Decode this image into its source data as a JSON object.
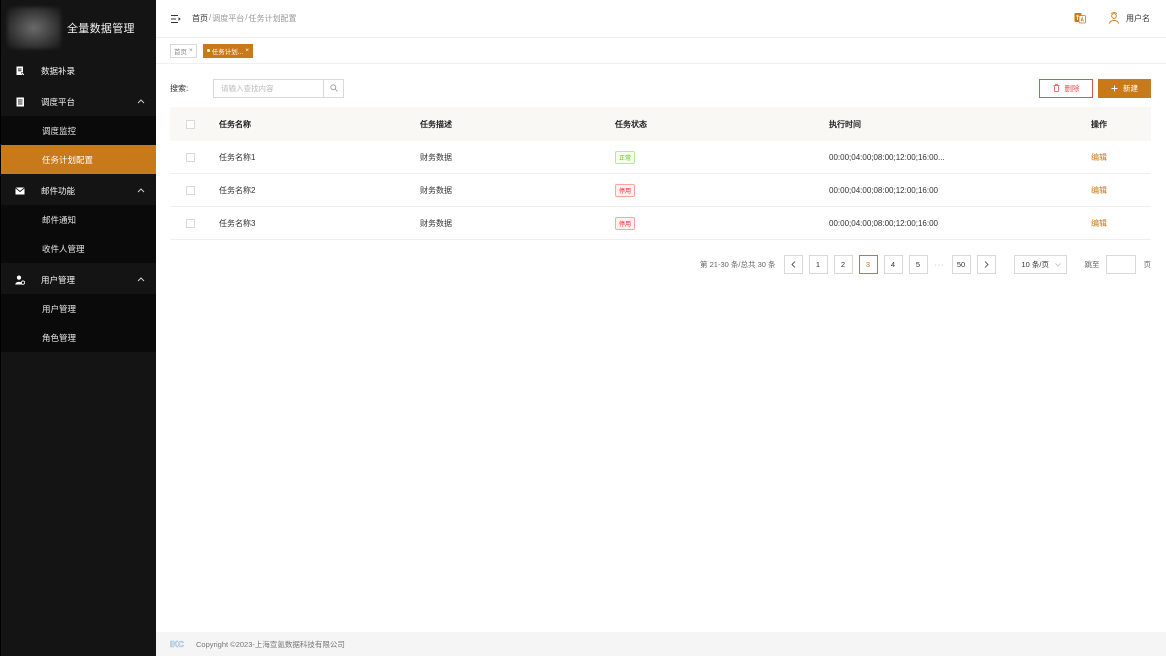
{
  "app": {
    "title": "全量数据管理"
  },
  "colors": {
    "accent": "#c8791a",
    "danger": "#e5534b",
    "sidebar_bg": "#141414"
  },
  "sidebar": {
    "groups": [
      {
        "label": "数据补录",
        "icon": "document-edit-icon",
        "items": []
      },
      {
        "label": "调度平台",
        "icon": "document-list-icon",
        "items": [
          {
            "label": "调度监控"
          },
          {
            "label": "任务计划配置",
            "active": true
          }
        ]
      },
      {
        "label": "邮件功能",
        "icon": "mail-icon",
        "items": [
          {
            "label": "邮件通知"
          },
          {
            "label": "收件人管理"
          }
        ]
      },
      {
        "label": "用户管理",
        "icon": "user-gear-icon",
        "items": [
          {
            "label": "用户管理"
          },
          {
            "label": "角色管理"
          }
        ]
      }
    ]
  },
  "header": {
    "breadcrumb": {
      "home": "首页",
      "sep": "/",
      "level1": "调度平台",
      "level2": "任务计划配置"
    },
    "user_name": "用户名"
  },
  "tags": [
    {
      "label": "首页",
      "close": "×"
    },
    {
      "label": "任务计划...",
      "close": "×",
      "active": true
    }
  ],
  "toolbar": {
    "search_label": "搜索:",
    "search_placeholder": "请输入查找内容",
    "delete_label": "删除",
    "new_label": "新建"
  },
  "table": {
    "columns": {
      "name": "任务名称",
      "desc": "任务描述",
      "status": "任务状态",
      "time": "执行时间",
      "op": "操作"
    },
    "rows": [
      {
        "name": "任务名称1",
        "desc": "财务数据",
        "status": "正常",
        "status_type": "ok",
        "time": "00:00;04:00;08:00;12:00;16:00...",
        "op": "编辑"
      },
      {
        "name": "任务名称2",
        "desc": "财务数据",
        "status": "停用",
        "status_type": "off",
        "time": "00:00;04:00;08:00;12:00;16:00",
        "op": "编辑"
      },
      {
        "name": "任务名称3",
        "desc": "财务数据",
        "status": "停用",
        "status_type": "off",
        "time": "00:00;04:00;08:00;12:00;16:00",
        "op": "编辑"
      }
    ]
  },
  "pagination": {
    "total_text": "第 21-30 条/总共 30 条",
    "pages": [
      "1",
      "2",
      "3",
      "4",
      "5"
    ],
    "current": "3",
    "ellipsis": "···",
    "last": "50",
    "page_size": "10 条/页",
    "jump_label": "跳至",
    "page_label": "页"
  },
  "footer": {
    "logo_text": "IKC",
    "copyright": "Copyright ©2023-上海宣氪数据科技有限公司"
  }
}
